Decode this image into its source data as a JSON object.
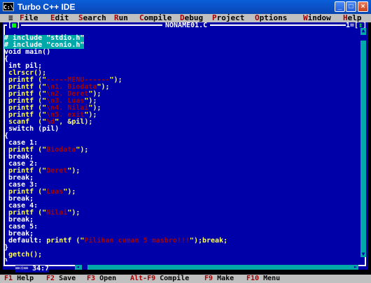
{
  "window": {
    "title": "Turbo C++ IDE",
    "icon_text": "C:\\",
    "min_glyph": "_",
    "max_glyph": "□",
    "close_glyph": "×"
  },
  "menu": [
    {
      "label": "≡",
      "hk": ""
    },
    {
      "label": "ile",
      "hk": "F"
    },
    {
      "label": "dit",
      "hk": "E"
    },
    {
      "label": "earch",
      "hk": "S"
    },
    {
      "label": "un",
      "hk": "R"
    },
    {
      "label": "ompile",
      "hk": "C"
    },
    {
      "label": "ebug",
      "hk": "D"
    },
    {
      "label": "roject",
      "hk": "P"
    },
    {
      "label": "ptions",
      "hk": "O"
    },
    {
      "label": "indow",
      "hk": "W"
    },
    {
      "label": "elp",
      "hk": "H"
    }
  ],
  "editor": {
    "close_box_left": "[",
    "close_box_mark": "■",
    "close_box_right": "]",
    "file_title": "NONAME01.C",
    "window_number": "1=[",
    "window_number_mark": "↕",
    "window_number_end": "]",
    "cursor_position": "34:7",
    "status_prefix": "═☼═"
  },
  "code_lines": [
    {
      "style": "hl",
      "parts": [
        {
          "t": "# include \"stdio.h\""
        }
      ]
    },
    {
      "style": "hl",
      "parts": [
        {
          "t": "# include \"conio.h\""
        }
      ]
    },
    {
      "style": "w",
      "parts": [
        {
          "t": "void main()"
        }
      ]
    },
    {
      "style": "w",
      "parts": [
        {
          "t": "{"
        }
      ]
    },
    {
      "style": "w",
      "parts": [
        {
          "t": " int pil;"
        }
      ]
    },
    {
      "style": "y",
      "parts": [
        {
          "t": " clrscr();"
        }
      ]
    },
    {
      "style": "y",
      "parts": [
        {
          "t": " printf (\""
        },
        {
          "t": "-----MENU------",
          "s": 1
        },
        {
          "t": "\");"
        }
      ]
    },
    {
      "style": "y",
      "parts": [
        {
          "t": " printf (\""
        },
        {
          "t": "\\n1. Biodata",
          "s": 1
        },
        {
          "t": "\");"
        }
      ]
    },
    {
      "style": "y",
      "parts": [
        {
          "t": " printf (\""
        },
        {
          "t": "\\n2. Deret",
          "s": 1
        },
        {
          "t": "\");"
        }
      ]
    },
    {
      "style": "y",
      "parts": [
        {
          "t": " printf (\""
        },
        {
          "t": "\\n3. Luas",
          "s": 1
        },
        {
          "t": "\");"
        }
      ]
    },
    {
      "style": "y",
      "parts": [
        {
          "t": " printf (\""
        },
        {
          "t": "\\n4. Nilai",
          "s": 1
        },
        {
          "t": "\");"
        }
      ]
    },
    {
      "style": "y",
      "parts": [
        {
          "t": " printf (\""
        },
        {
          "t": "\\n5. exit",
          "s": 1
        },
        {
          "t": "\");"
        }
      ]
    },
    {
      "style": "y",
      "parts": [
        {
          "t": " scanf  (\""
        },
        {
          "t": "%d",
          "s": 1
        },
        {
          "t": "\", &pil);"
        }
      ]
    },
    {
      "style": "w",
      "parts": [
        {
          "t": " switch (pil)"
        }
      ]
    },
    {
      "style": "w",
      "parts": [
        {
          "t": "{"
        }
      ]
    },
    {
      "style": "w",
      "parts": [
        {
          "t": " case 1:"
        }
      ]
    },
    {
      "style": "y",
      "parts": [
        {
          "t": " printf (\""
        },
        {
          "t": "Biodata",
          "s": 1
        },
        {
          "t": "\");"
        }
      ]
    },
    {
      "style": "w",
      "parts": [
        {
          "t": " break;"
        }
      ]
    },
    {
      "style": "w",
      "parts": [
        {
          "t": " case 2:"
        }
      ]
    },
    {
      "style": "y",
      "parts": [
        {
          "t": " printf (\""
        },
        {
          "t": "Deret",
          "s": 1
        },
        {
          "t": "\");"
        }
      ]
    },
    {
      "style": "w",
      "parts": [
        {
          "t": " break;"
        }
      ]
    },
    {
      "style": "w",
      "parts": [
        {
          "t": " case 3:"
        }
      ]
    },
    {
      "style": "y",
      "parts": [
        {
          "t": " printf (\""
        },
        {
          "t": "Luas",
          "s": 1
        },
        {
          "t": "\");"
        }
      ]
    },
    {
      "style": "w",
      "parts": [
        {
          "t": " break;"
        }
      ]
    },
    {
      "style": "w",
      "parts": [
        {
          "t": " case 4:"
        }
      ]
    },
    {
      "style": "y",
      "parts": [
        {
          "t": " printf (\""
        },
        {
          "t": "Nilai",
          "s": 1
        },
        {
          "t": "\");"
        }
      ]
    },
    {
      "style": "w",
      "parts": [
        {
          "t": " break;"
        }
      ]
    },
    {
      "style": "w",
      "parts": [
        {
          "t": " case 5:"
        }
      ]
    },
    {
      "style": "w",
      "parts": [
        {
          "t": " break;"
        }
      ]
    },
    {
      "style": "w",
      "parts": [
        {
          "t": " default: "
        },
        {
          "t": "printf (\"",
          "y": 1
        },
        {
          "t": "Pilihan cuman 5 masbro!!!",
          "s": 1
        },
        {
          "t": "\");break;",
          "y": 1
        }
      ]
    },
    {
      "style": "w",
      "parts": [
        {
          "t": "}"
        }
      ]
    },
    {
      "style": "y",
      "parts": [
        {
          "t": " getch();"
        }
      ]
    },
    {
      "style": "w",
      "parts": [
        {
          "t": "}"
        }
      ]
    }
  ],
  "hints": [
    {
      "key": "F1",
      "label": " Help"
    },
    {
      "key": "F2",
      "label": " Save"
    },
    {
      "key": "F3",
      "label": " Open"
    },
    {
      "key": "Alt-F9",
      "label": " Compile"
    },
    {
      "key": "F9",
      "label": " Make"
    },
    {
      "key": "F10",
      "label": " Menu"
    }
  ],
  "colors": {
    "editor_bg": "#0000a8",
    "string": "#a80000",
    "keyword_yellow": "#ffff55",
    "highlight": "#00a8a8",
    "menubar": "#c0c0c0"
  }
}
